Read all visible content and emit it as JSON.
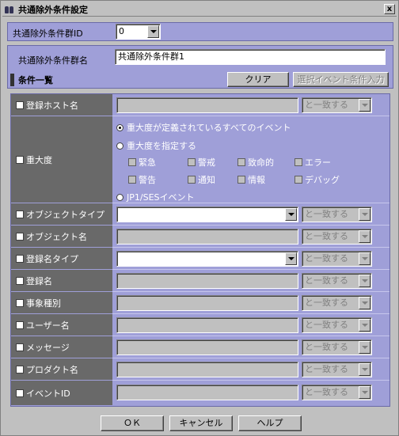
{
  "window": {
    "title": "共通除外条件設定",
    "close_label": "x"
  },
  "group_id": {
    "label": "共通除外条件群ID",
    "value": "0"
  },
  "group_name": {
    "label": "共通除外条件群名",
    "value": "共通除外条件群1"
  },
  "conditions": {
    "title": "条件一覧",
    "clear_label": "クリア",
    "select_event_label": "選択イベント条件入力"
  },
  "match_option": "と一致する",
  "rows": {
    "host": {
      "label": "登録ホスト名"
    },
    "severity": {
      "label": "重大度",
      "all_events": "重大度が定義されているすべてのイベント",
      "specify": "重大度を指定する",
      "levels_row1": [
        "緊急",
        "警戒",
        "致命的",
        "エラー"
      ],
      "levels_row2": [
        "警告",
        "通知",
        "情報",
        "デバッグ"
      ],
      "jp1": "JP1/SESイベント"
    },
    "object_type": {
      "label": "オブジェクトタイプ"
    },
    "object_name": {
      "label": "オブジェクト名"
    },
    "reg_type": {
      "label": "登録名タイプ"
    },
    "reg_name": {
      "label": "登録名"
    },
    "event_type": {
      "label": "事象種別"
    },
    "user": {
      "label": "ユーザー名"
    },
    "message": {
      "label": "メッセージ"
    },
    "product": {
      "label": "プロダクト名"
    },
    "event_id": {
      "label": "イベントID"
    }
  },
  "footer": {
    "ok": "ＯＫ",
    "cancel": "キャンセル",
    "help": "ヘルプ"
  }
}
